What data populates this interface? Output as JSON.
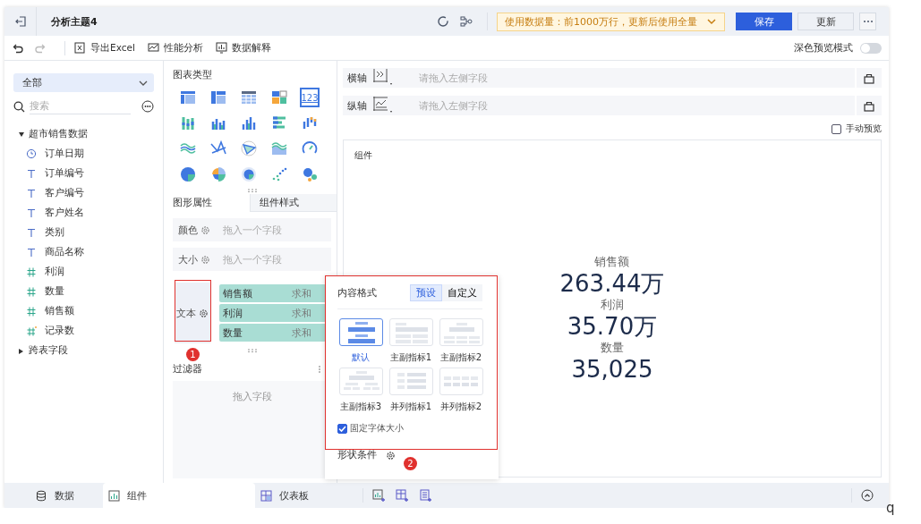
{
  "window": {
    "title": "分析主题4"
  },
  "header": {
    "notice": "使用数据量：前1000万行，更新后使用全量",
    "buttons": [
      {
        "label": "保存",
        "kind": "primary"
      },
      {
        "label": "更新",
        "kind": "default"
      }
    ]
  },
  "toolbar": {
    "actions": [
      {
        "label": "导出Excel",
        "kind": "excel"
      },
      {
        "label": "性能分析",
        "kind": "perf"
      },
      {
        "label": "数据解释",
        "kind": "explain"
      }
    ],
    "dark_mode": {
      "label": "深色预览模式",
      "on": false
    }
  },
  "fields_panel": {
    "scope": "全部",
    "search": {
      "placeholder": "搜索"
    },
    "tree": [
      {
        "label": "超市销售数据",
        "expanded": true,
        "children": [
          {
            "label": "订单日期",
            "kind": "date"
          },
          {
            "label": "订单编号",
            "kind": "text"
          },
          {
            "label": "客户编号",
            "kind": "text"
          },
          {
            "label": "客户姓名",
            "kind": "text"
          },
          {
            "label": "类别",
            "kind": "text"
          },
          {
            "label": "商品名称",
            "kind": "text"
          },
          {
            "label": "利润",
            "kind": "number"
          },
          {
            "label": "数量",
            "kind": "number"
          },
          {
            "label": "销售额",
            "kind": "number"
          },
          {
            "label": "记录数",
            "kind": "count"
          }
        ]
      },
      {
        "label": "跨表字段",
        "expanded": false
      }
    ]
  },
  "chart_panel": {
    "title": "图表类型",
    "chart_types": [
      {
        "kind": "table",
        "selected": false
      },
      {
        "kind": "cross-table",
        "selected": false
      },
      {
        "kind": "detail-table",
        "selected": false
      },
      {
        "kind": "tiles",
        "selected": false
      },
      {
        "kind": "kpi",
        "label": "123",
        "selected": true
      },
      {
        "kind": "stacked-column",
        "selected": false
      },
      {
        "kind": "column",
        "selected": false
      },
      {
        "kind": "multi-column",
        "selected": false
      },
      {
        "kind": "stacked-bar",
        "selected": false
      },
      {
        "kind": "range-column",
        "selected": false
      },
      {
        "kind": "line",
        "selected": false
      },
      {
        "kind": "star-line",
        "selected": false
      },
      {
        "kind": "radar",
        "selected": false
      },
      {
        "kind": "area",
        "selected": false
      },
      {
        "kind": "gauge",
        "selected": false
      },
      {
        "kind": "pie",
        "selected": false
      },
      {
        "kind": "rose",
        "selected": false
      },
      {
        "kind": "donut",
        "selected": false
      },
      {
        "kind": "scatter",
        "selected": false
      },
      {
        "kind": "bubble",
        "selected": false
      }
    ],
    "tabs": [
      {
        "label": "图形属性",
        "selected": true
      },
      {
        "label": "组件样式",
        "selected": false
      }
    ],
    "properties": [
      {
        "kind": "drop",
        "label": "颜色",
        "placeholder": "拖入一个字段"
      },
      {
        "kind": "drop",
        "label": "大小",
        "placeholder": "拖入一个字段"
      },
      {
        "kind": "fields",
        "label": "文本",
        "fields": [
          {
            "name": "销售额",
            "aggregation": "求和"
          },
          {
            "name": "利润",
            "aggregation": "求和"
          },
          {
            "name": "数量",
            "aggregation": "求和"
          }
        ]
      }
    ],
    "filter": {
      "title": "过滤器",
      "placeholder": "拖入字段"
    }
  },
  "axes": [
    {
      "label": "横轴",
      "kind": "x",
      "placeholder": "请拖入左侧字段"
    },
    {
      "label": "纵轴",
      "kind": "y",
      "placeholder": "请拖入左侧字段"
    }
  ],
  "manual_preview": {
    "label": "手动预览",
    "checked": false
  },
  "canvas": {
    "title": "组件",
    "kpis": [
      {
        "label": "销售额",
        "value": "263.44万"
      },
      {
        "label": "利润",
        "value": "35.70万"
      },
      {
        "label": "数量",
        "value": "35,025"
      }
    ]
  },
  "format_popup": {
    "title": "内容格式",
    "modes": [
      {
        "label": "预设",
        "selected": true
      },
      {
        "label": "自定义",
        "selected": false
      }
    ],
    "presets": [
      {
        "label": "默认",
        "kind": "center",
        "selected": true
      },
      {
        "label": "主副指标1",
        "kind": "main-sub-1",
        "selected": false
      },
      {
        "label": "主副指标2",
        "kind": "main-sub-2",
        "selected": false
      },
      {
        "label": "主副指标3",
        "kind": "main-sub-3",
        "selected": false
      },
      {
        "label": "并列指标1",
        "kind": "parallel-1",
        "selected": false
      },
      {
        "label": "并列指标2",
        "kind": "parallel-2",
        "selected": false
      }
    ],
    "fixed_font": {
      "label": "固定字体大小",
      "checked": true
    },
    "shape_condition": {
      "label": "形状条件"
    }
  },
  "annotations": [
    {
      "kind": "text-property",
      "badge": "1"
    },
    {
      "kind": "format-popup",
      "badge": "2"
    }
  ],
  "bottom_bar": {
    "tabs": [
      {
        "label": "数据",
        "kind": "data",
        "selected": false
      },
      {
        "label": "组件",
        "kind": "widget",
        "selected": true
      },
      {
        "label": "仪表板",
        "kind": "dashboard",
        "selected": false
      }
    ]
  },
  "stray_text": "q"
}
